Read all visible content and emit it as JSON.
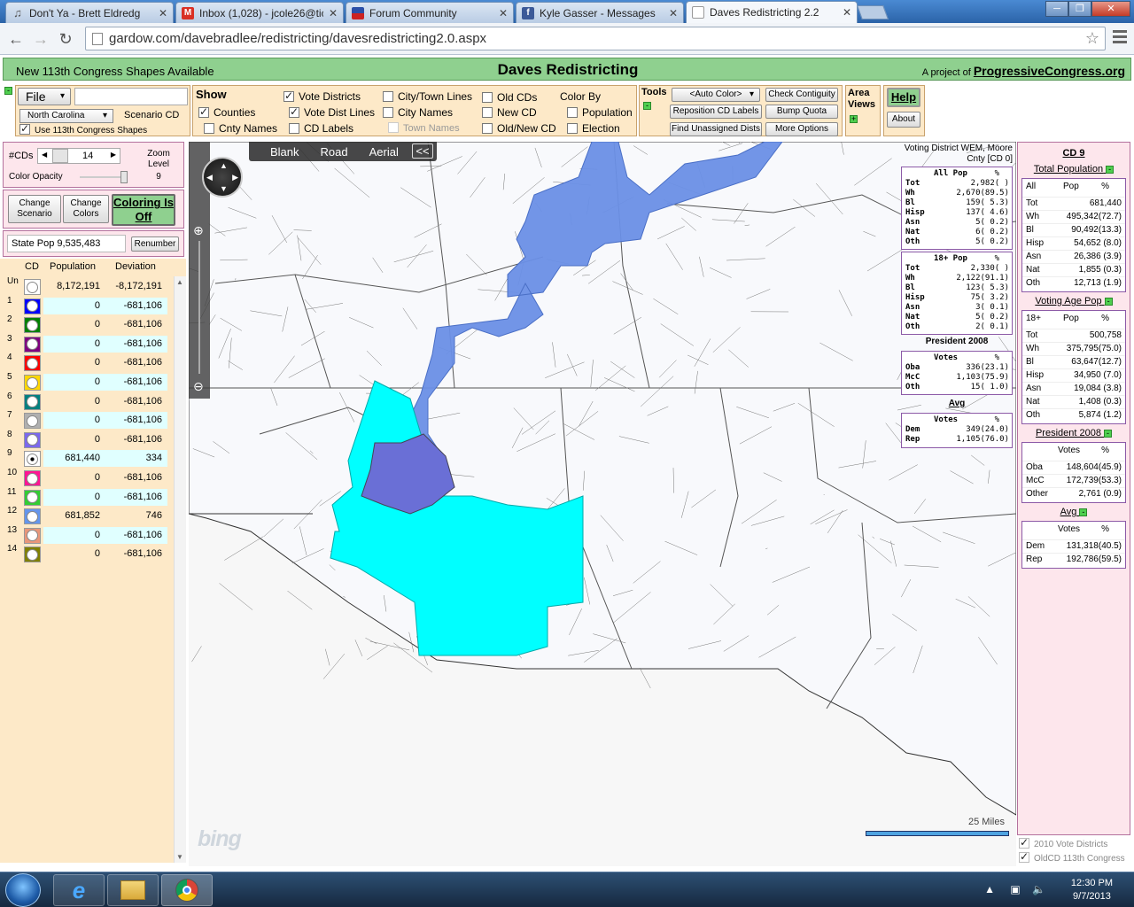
{
  "browser": {
    "tabs": [
      {
        "title": "Don't Ya - Brett Eldredg",
        "icon": "music-note-icon"
      },
      {
        "title": "Inbox (1,028) - jcole26@tic",
        "icon": "gmail-icon"
      },
      {
        "title": "Forum Community",
        "icon": "flag-icon"
      },
      {
        "title": "Kyle Gasser - Messages",
        "icon": "facebook-icon"
      },
      {
        "title": "Daves Redistricting 2.2",
        "icon": "page-icon"
      }
    ],
    "url": "gardow.com/davebradlee/redistricting/davesredistricting2.0.aspx"
  },
  "header": {
    "notice": "New 113th Congress Shapes Available",
    "title": "Daves Redistricting",
    "project_prefix": "A project of",
    "project_link": "ProgressiveCongress.org"
  },
  "file_panel": {
    "file_label": "File",
    "state": "North Carolina",
    "scenario": "Scenario CD",
    "use_113": "Use 113th Congress Shapes"
  },
  "show_panel": {
    "title": "Show",
    "counties": "Counties",
    "cnty_names": "Cnty Names",
    "vote_districts": "Vote Districts",
    "vote_dist_lines": "Vote Dist Lines",
    "cd_labels": "CD Labels",
    "city_town_lines": "City/Town Lines",
    "city_names": "City Names",
    "town_names": "Town Names",
    "old_cds": "Old CDs",
    "new_cd": "New CD",
    "old_new_cd": "Old/New CD",
    "color_by": "Color By",
    "population": "Population",
    "election": "Election"
  },
  "tools_panel": {
    "title": "Tools",
    "auto_color": "<Auto Color>",
    "check_contiguity": "Check Contiguity",
    "reposition_labels": "Reposition CD Labels",
    "bump_quota": "Bump Quota",
    "find_unassigned": "Find Unassigned Dists",
    "more_options": "More Options",
    "area_views": "Area Views",
    "help": "Help",
    "about": "About"
  },
  "left_controls": {
    "cds_label": "#CDs",
    "cds_value": "14",
    "zoom_label": "Zoom Level",
    "zoom_value": "9",
    "opacity_label": "Color Opacity",
    "change_scenario": "Change Scenario",
    "change_colors": "Change Colors",
    "coloring": "Coloring Is Off",
    "state_pop_label": "State Pop",
    "state_pop_value": "9,535,483",
    "renumber": "Renumber"
  },
  "cd_table": {
    "headers": [
      "CD",
      "Population",
      "Deviation"
    ],
    "rows": [
      {
        "cd": "Un",
        "pop": "8,172,191",
        "dev": "-8,172,191",
        "color": "#ffffff",
        "row_bg": "#fde9c8"
      },
      {
        "cd": "1",
        "pop": "0",
        "dev": "-681,106",
        "color": "#0000ff",
        "row_bg": "#e0ffff"
      },
      {
        "cd": "2",
        "pop": "0",
        "dev": "-681,106",
        "color": "#008000",
        "row_bg": "#fde9c8"
      },
      {
        "cd": "3",
        "pop": "0",
        "dev": "-681,106",
        "color": "#800080",
        "row_bg": "#e0ffff"
      },
      {
        "cd": "4",
        "pop": "0",
        "dev": "-681,106",
        "color": "#ff0000",
        "row_bg": "#fde9c8"
      },
      {
        "cd": "5",
        "pop": "0",
        "dev": "-681,106",
        "color": "#ffd700",
        "row_bg": "#e0ffff"
      },
      {
        "cd": "6",
        "pop": "0",
        "dev": "-681,106",
        "color": "#008080",
        "row_bg": "#fde9c8"
      },
      {
        "cd": "7",
        "pop": "0",
        "dev": "-681,106",
        "color": "#b0b0b0",
        "row_bg": "#e0ffff"
      },
      {
        "cd": "8",
        "pop": "0",
        "dev": "-681,106",
        "color": "#7b68ee",
        "row_bg": "#fde9c8"
      },
      {
        "cd": "9",
        "pop": "681,440",
        "dev": "334",
        "color": "#ffffff",
        "row_bg": "#e0ffff"
      },
      {
        "cd": "10",
        "pop": "0",
        "dev": "-681,106",
        "color": "#ff1493",
        "row_bg": "#fde9c8"
      },
      {
        "cd": "11",
        "pop": "0",
        "dev": "-681,106",
        "color": "#32cd32",
        "row_bg": "#e0ffff"
      },
      {
        "cd": "12",
        "pop": "681,852",
        "dev": "746",
        "color": "#6495ed",
        "row_bg": "#fde9c8"
      },
      {
        "cd": "13",
        "pop": "0",
        "dev": "-681,106",
        "color": "#e9967a",
        "row_bg": "#e0ffff"
      },
      {
        "cd": "14",
        "pop": "0",
        "dev": "-681,106",
        "color": "#808000",
        "row_bg": "#fde9c8"
      }
    ]
  },
  "map": {
    "views": [
      "Blank",
      "Road",
      "Aerial"
    ],
    "collapse": "<<",
    "logo": "bing",
    "scale": "25 Miles",
    "vd_title": "Voting District WEM, Moore Cnty [CD 0]",
    "all_pop": {
      "header": [
        "All Pop",
        "%"
      ],
      "rows": [
        [
          "Tot",
          "2,982(    )"
        ],
        [
          "Wh",
          "2,670(89.5)"
        ],
        [
          "Bl",
          "159( 5.3)"
        ],
        [
          "Hisp",
          "137( 4.6)"
        ],
        [
          "Asn",
          "5( 0.2)"
        ],
        [
          "Nat",
          "6( 0.2)"
        ],
        [
          "Oth",
          "5( 0.2)"
        ]
      ]
    },
    "pop18": {
      "header": [
        "18+ Pop",
        "%"
      ],
      "rows": [
        [
          "Tot",
          "2,330(    )"
        ],
        [
          "Wh",
          "2,122(91.1)"
        ],
        [
          "Bl",
          "123( 5.3)"
        ],
        [
          "Hisp",
          "75( 3.2)"
        ],
        [
          "Asn",
          "3( 0.1)"
        ],
        [
          "Nat",
          "5( 0.2)"
        ],
        [
          "Oth",
          "2( 0.1)"
        ]
      ]
    },
    "pres_title": "President 2008",
    "pres": {
      "header": [
        "Votes",
        "%"
      ],
      "rows": [
        [
          "Oba",
          "336(23.1)"
        ],
        [
          "McC",
          "1,103(75.9)"
        ],
        [
          "Oth",
          "15( 1.0)"
        ]
      ]
    },
    "avg_title": "Avg",
    "avg": {
      "header": [
        "Votes",
        "%"
      ],
      "rows": [
        [
          "Dem",
          "349(24.0)"
        ],
        [
          "Rep",
          "1,105(76.0)"
        ]
      ]
    }
  },
  "right_panel": {
    "cd_title": "CD 9",
    "total_pop_title": "Total Population",
    "total_pop": {
      "header": [
        "All",
        "Pop",
        "%"
      ],
      "rows": [
        [
          "Tot",
          "681,440"
        ],
        [
          "Wh",
          "495,342(72.7)"
        ],
        [
          "Bl",
          "90,492(13.3)"
        ],
        [
          "Hisp",
          "54,652 (8.0)"
        ],
        [
          "Asn",
          "26,386 (3.9)"
        ],
        [
          "Nat",
          "1,855 (0.3)"
        ],
        [
          "Oth",
          "12,713 (1.9)"
        ]
      ]
    },
    "vap_title": "Voting Age Pop",
    "vap": {
      "header": [
        "18+",
        "Pop",
        "%"
      ],
      "rows": [
        [
          "Tot",
          "500,758"
        ],
        [
          "Wh",
          "375,795(75.0)"
        ],
        [
          "Bl",
          "63,647(12.7)"
        ],
        [
          "Hisp",
          "34,950 (7.0)"
        ],
        [
          "Asn",
          "19,084 (3.8)"
        ],
        [
          "Nat",
          "1,408 (0.3)"
        ],
        [
          "Oth",
          "5,874 (1.2)"
        ]
      ]
    },
    "pres_title": "President 2008",
    "pres": {
      "header": [
        "Votes",
        "%"
      ],
      "rows": [
        [
          "Oba",
          "148,604(45.9)"
        ],
        [
          "McC",
          "172,739(53.3)"
        ],
        [
          "Other",
          "2,761 (0.9)"
        ]
      ]
    },
    "avg_title": "Avg",
    "avg": {
      "header": [
        "Votes",
        "%"
      ],
      "rows": [
        [
          "Dem",
          "131,318(40.5)"
        ],
        [
          "Rep",
          "192,786(59.5)"
        ]
      ]
    },
    "check_2010": "2010 Vote Districts",
    "check_oldcd": "OldCD 113th Congress"
  },
  "taskbar": {
    "time": "12:30 PM",
    "date": "9/7/2013"
  },
  "colors": {
    "header_green": "#8fd08f",
    "panel_tan": "#fde9c8",
    "panel_pink": "#fde6ec",
    "district_cyan": "#00ffff",
    "district_blue": "#6495ed",
    "district_slate": "#7b68ee"
  }
}
